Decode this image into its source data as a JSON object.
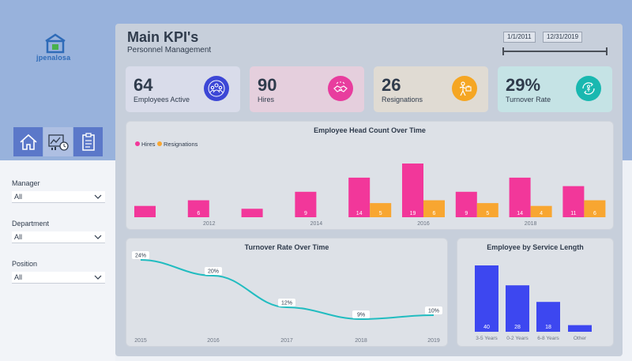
{
  "brand": {
    "logo_text": "jpenalosa"
  },
  "header": {
    "title": "Main KPI's",
    "subtitle": "Personnel Management"
  },
  "date_range": {
    "start": "1/1/2011",
    "end": "12/31/2019"
  },
  "filters": [
    {
      "label": "Manager",
      "value": "All"
    },
    {
      "label": "Department",
      "value": "All"
    },
    {
      "label": "Position",
      "value": "All"
    }
  ],
  "kpis": [
    {
      "value": "64",
      "label": "Employees Active",
      "color": "#3d47d6",
      "icon": "team-icon"
    },
    {
      "value": "90",
      "label": "Hires",
      "color": "#e83d9e",
      "icon": "handshake-icon"
    },
    {
      "value": "26",
      "label": "Resignations",
      "color": "#f5a623",
      "icon": "resignation-icon"
    },
    {
      "value": "29%",
      "label": "Turnover Rate",
      "color": "#19b8b0",
      "icon": "turnover-icon"
    }
  ],
  "chart_data": [
    {
      "type": "bar",
      "title": "Employee Head Count Over Time",
      "legend_position": "top-left",
      "series": [
        {
          "name": "Hires",
          "color": "#f2379a",
          "values": [
            4,
            6,
            3,
            9,
            14,
            19,
            9,
            14,
            11
          ],
          "labels": [
            "",
            "6",
            "",
            "9",
            "14",
            "19",
            "9",
            "14",
            "11"
          ]
        },
        {
          "name": "Resignations",
          "color": "#f8a631",
          "values": [
            0,
            0,
            0,
            0,
            5,
            6,
            5,
            4,
            6
          ],
          "labels": [
            "",
            "",
            "",
            "",
            "5",
            "6",
            "5",
            "4",
            "6"
          ]
        }
      ],
      "x_ticks": [
        "2012",
        "2014",
        "2016",
        "2018"
      ]
    },
    {
      "type": "line",
      "title": "Turnover Rate Over Time",
      "color": "#21bcc0",
      "x": [
        "2015",
        "2016",
        "2017",
        "2018",
        "2019"
      ],
      "values": [
        24,
        20,
        12,
        9,
        10
      ],
      "labels": [
        "24%",
        "20%",
        "12%",
        "9%",
        "10%"
      ]
    },
    {
      "type": "bar",
      "title": "Employee by Service Length",
      "color": "#3d47f0",
      "categories": [
        "3-5 Years",
        "0-2 Years",
        "6-8 Years",
        "Other"
      ],
      "values": [
        40,
        28,
        18,
        4
      ],
      "labels": [
        "40",
        "28",
        "18",
        ""
      ]
    }
  ]
}
